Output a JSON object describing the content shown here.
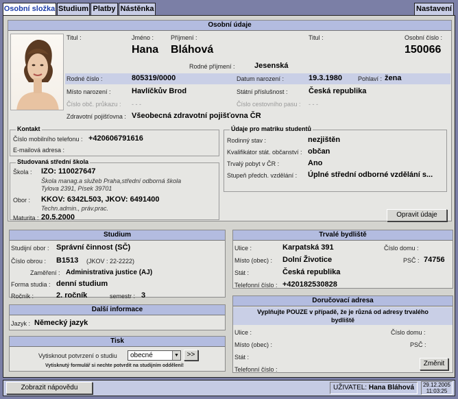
{
  "tabs": [
    "Osobní složka",
    "Studium",
    "Platby",
    "Nástěnka"
  ],
  "settings_tab": "Nastavení",
  "personal": {
    "header": "Osobní údaje",
    "titul_label": "Titul :",
    "jmeno_label": "Jméno :",
    "prijmeni_label": "Příjmení :",
    "titul2_label": "Titul :",
    "osobni_cislo_label": "Osobní číslo :",
    "jmeno": "Hana",
    "prijmeni": "Bláhová",
    "osobni_cislo": "150066",
    "rodne_prijmeni_label": "Rodné příjmení :",
    "rodne_prijmeni": "Jesenská",
    "rodne_cislo_label": "Rodné číslo :",
    "rodne_cislo": "805319/0000",
    "datum_narozeni_label": "Datum narození :",
    "datum_narozeni": "19.3.1980",
    "pohlavi_label": "Pohlaví :",
    "pohlavi": "žena",
    "misto_narozeni_label": "Místo narození :",
    "misto_narozeni": "Havlíčkův Brod",
    "statni_prislusnost_label": "Státní příslušnost :",
    "statni_prislusnost": "Česká republika",
    "cislo_op_label": "Číslo obč. průkazu :",
    "cislo_op": "- - -",
    "cislo_pasu_label": "Číslo cestovního pasu :",
    "cislo_pasu": "- - -",
    "pojistovna_label": "Zdravotní pojišťovna :",
    "pojistovna": "Všeobecná zdravotní pojišťovna ČR"
  },
  "contact": {
    "title": "Kontakt",
    "mobile_label": "Číslo mobilního telefonu :",
    "mobile": "+420606791616",
    "email_label": "E-mailová adresa :"
  },
  "school": {
    "title": "Studovaná střední škola",
    "skola_label": "Škola :",
    "izo": "IZO: 110027647",
    "skola_line1": "Škola manag.a služeb Praha,střední odborná škola",
    "skola_line2": "Tylova 2391, Písek 39701",
    "obor_label": "Obor :",
    "obor": "KKOV: 6342L503, JKOV: 6491400",
    "obor_sub": "Techn.admin., práv.prac.",
    "maturita_label": "Maturita :",
    "maturita": "20.5.2000"
  },
  "matrika": {
    "title": "Údaje pro matriku studentů",
    "rodinny_stav_label": "Rodinný stav :",
    "rodinny_stav": "nezjištěn",
    "kvalifikator_label": "Kvalifikátor stát. občanství :",
    "kvalifikator": "občan",
    "trvaly_pobyt_label": "Trvalý pobyt v ČR :",
    "trvaly_pobyt": "Ano",
    "stupen_label": "Stupeň předch. vzdělání :",
    "stupen": "Úplné střední odborné vzdělání s..."
  },
  "edit_button": "Opravit údaje",
  "study": {
    "header": "Studium",
    "obor_label": "Studijní obor :",
    "obor": "Správní činnost (SČ)",
    "cislo_obor_label": "Číslo obrou :",
    "cislo_obor": "B1513",
    "jkov": "(JKOV : 22-2222)",
    "zamereni_label": "Zaměření :",
    "zamereni": "Administrativa justice (AJ)",
    "forma_label": "Forma studia :",
    "forma": "denní studium",
    "rocnik_label": "Ročník :",
    "rocnik": "2. ročník",
    "semestr_label": "semestr :",
    "semestr": "3"
  },
  "extra": {
    "header": "Další informace",
    "jazyk_label": "Jazyk :",
    "jazyk": "Německý jazyk"
  },
  "print": {
    "header": "Tisk",
    "label": "Vytisknout potvrzení o studiu",
    "selected": "obecné",
    "go": ">>",
    "note": "Vytisknutý formulář si nechte potvrdit na studijním oddělení!"
  },
  "permanent": {
    "header": "Trvalé bydliště",
    "ulice_label": "Ulice :",
    "ulice": "Karpatská 391",
    "cislo_domu_label": "Číslo domu :",
    "misto_label": "Místo (obec) :",
    "misto": "Dolní Životice",
    "psc_label": "PSČ :",
    "psc": "74756",
    "stat_label": "Stát :",
    "stat": "Česká republika",
    "telefon_label": "Telefonní číslo :",
    "telefon": "+420182530828"
  },
  "mailing": {
    "header": "Doručovací adresa",
    "note": "Vyplňujte POUZE v případě, že je různá od adresy trvalého bydliště",
    "ulice_label": "Ulice :",
    "cislo_domu_label": "Číslo domu :",
    "misto_label": "Místo (obec) :",
    "psc_label": "PSČ :",
    "stat_label": "Stát :",
    "telefon_label": "Telefonní číslo :",
    "change_button": "Změnit"
  },
  "footer": {
    "help_button": "Zobrazit nápovědu",
    "user_label": "UŽIVATEL:",
    "user_name": "Hana Bláhová",
    "date": "29.12.2005",
    "time": "11:03:25"
  },
  "colors": {
    "background": "#7b7fa6",
    "panel_header": "#b3bce0",
    "active_tab_text": "#1c3da8"
  }
}
